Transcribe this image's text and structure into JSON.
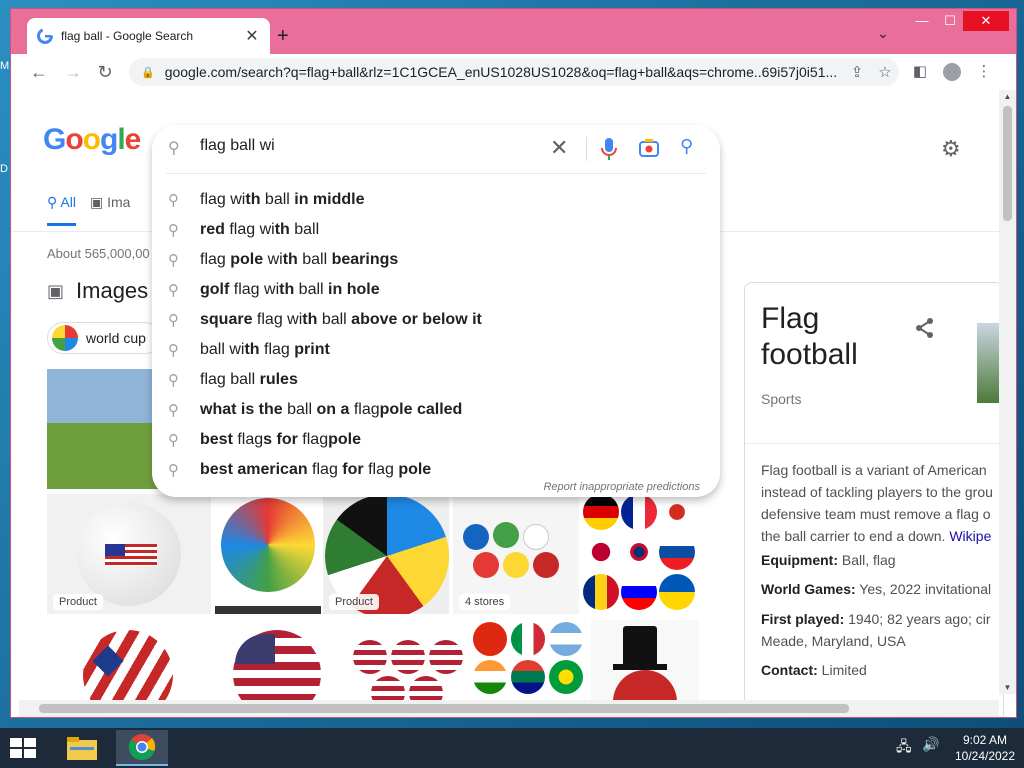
{
  "desktop": {
    "edge_labels": [
      "M",
      "D"
    ]
  },
  "browser": {
    "tab_title": "flag ball - Google Search",
    "url": "google.com/search?q=flag+ball&rlz=1C1GCEA_enUS1028US1028&oq=flag+ball&aqs=chrome..69i57j0i51..."
  },
  "google": {
    "logo": [
      "G",
      "o",
      "o",
      "g",
      "l",
      "e"
    ],
    "nav": {
      "all": "All",
      "images": "Ima"
    },
    "stats": "About 565,000,00",
    "images_header": "Images",
    "chip_label": "world cup",
    "badges": {
      "product1": "Product",
      "product2": "Product",
      "stores": "4 stores"
    }
  },
  "search": {
    "query": "flag ball wi",
    "suggestions": [
      [
        {
          "t": "flag wi",
          "b": false
        },
        {
          "t": "th",
          "b": true
        },
        {
          "t": " ball ",
          "b": false
        },
        {
          "t": "in middle",
          "b": true
        }
      ],
      [
        {
          "t": "red",
          "b": true
        },
        {
          "t": " flag wi",
          "b": false
        },
        {
          "t": "th",
          "b": true
        },
        {
          "t": " ball",
          "b": false
        }
      ],
      [
        {
          "t": "flag ",
          "b": false
        },
        {
          "t": "pole",
          "b": true
        },
        {
          "t": " wi",
          "b": false
        },
        {
          "t": "th",
          "b": true
        },
        {
          "t": " ball ",
          "b": false
        },
        {
          "t": "bearings",
          "b": true
        }
      ],
      [
        {
          "t": "golf",
          "b": true
        },
        {
          "t": " flag wi",
          "b": false
        },
        {
          "t": "th",
          "b": true
        },
        {
          "t": " ball ",
          "b": false
        },
        {
          "t": "in hole",
          "b": true
        }
      ],
      [
        {
          "t": "square",
          "b": true
        },
        {
          "t": " flag wi",
          "b": false
        },
        {
          "t": "th",
          "b": true
        },
        {
          "t": " ball ",
          "b": false
        },
        {
          "t": "above or below it",
          "b": true
        }
      ],
      [
        {
          "t": "ball wi",
          "b": false
        },
        {
          "t": "th",
          "b": true
        },
        {
          "t": " flag ",
          "b": false
        },
        {
          "t": "print",
          "b": true
        }
      ],
      [
        {
          "t": "flag ball ",
          "b": false
        },
        {
          "t": "rules",
          "b": true
        }
      ],
      [
        {
          "t": "what is the",
          "b": true
        },
        {
          "t": " ball ",
          "b": false
        },
        {
          "t": "on a",
          "b": true
        },
        {
          "t": " flag",
          "b": false
        },
        {
          "t": "pole called",
          "b": true
        }
      ],
      [
        {
          "t": "best",
          "b": true
        },
        {
          "t": " flag",
          "b": false
        },
        {
          "t": "s",
          "b": true
        },
        {
          "t": " ",
          "b": false
        },
        {
          "t": "for",
          "b": true
        },
        {
          "t": " flag",
          "b": false
        },
        {
          "t": "pole",
          "b": true
        }
      ],
      [
        {
          "t": "best american",
          "b": true
        },
        {
          "t": " flag ",
          "b": false
        },
        {
          "t": "for",
          "b": true
        },
        {
          "t": " flag ",
          "b": false
        },
        {
          "t": "pole",
          "b": true
        }
      ]
    ],
    "report": "Report inappropriate predictions"
  },
  "knowledge_panel": {
    "title": "Flag football",
    "subtitle": "Sports",
    "desc_lines": [
      "Flag football is a variant of American",
      "instead of tackling players to the grou",
      "defensive team must remove a flag o",
      "the ball carrier to end a down. "
    ],
    "desc_link": "Wikipe",
    "facts": [
      {
        "label": "Equipment:",
        "value": " Ball, flag"
      },
      {
        "label": "World Games:",
        "value": " Yes, 2022 invitational"
      },
      {
        "label": "First played:",
        "value": " 1940; 82 years ago; cir"
      },
      {
        "label": "",
        "value": "Meade, Maryland, USA"
      },
      {
        "label": "Contact:",
        "value": " Limited"
      }
    ]
  },
  "taskbar": {
    "time": "9:02 AM",
    "date": "10/24/2022"
  }
}
